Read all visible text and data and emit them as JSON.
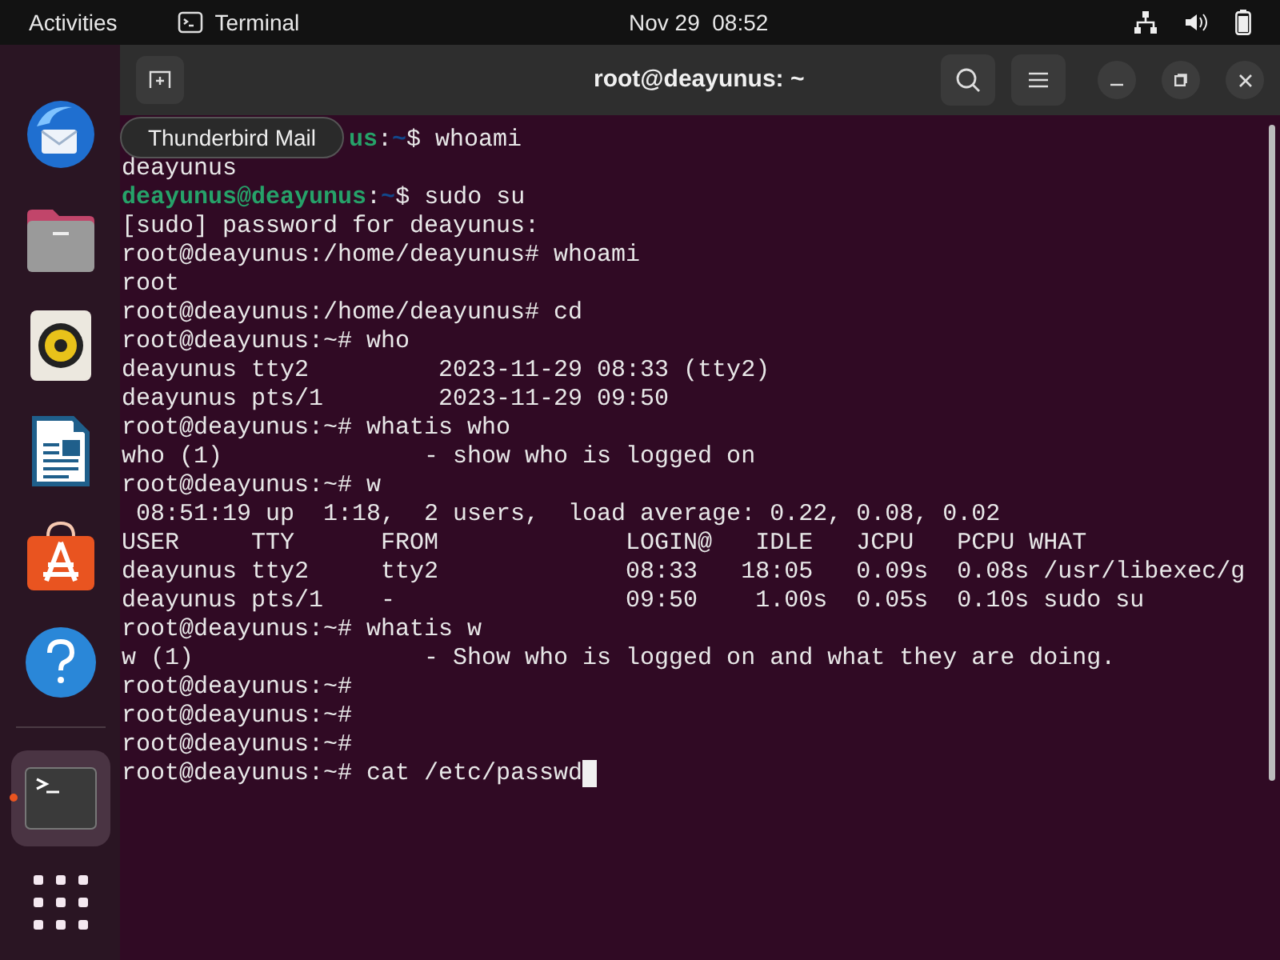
{
  "top_bar": {
    "activities": "Activities",
    "app_name": "Terminal",
    "clock": "Nov 29  08:52"
  },
  "dock": {
    "items": [
      {
        "kind": "mail",
        "running": false
      },
      {
        "kind": "files",
        "running": false
      },
      {
        "kind": "music",
        "running": false
      },
      {
        "kind": "writer",
        "running": false
      },
      {
        "kind": "store",
        "running": false
      },
      {
        "kind": "help",
        "running": false
      },
      {
        "kind": "terminal",
        "running": true
      }
    ],
    "tooltip": "Thunderbird Mail"
  },
  "window": {
    "title": "root@deayunus: ~"
  },
  "terminal": {
    "lines": [
      [
        {
          "text": "us",
          "kind": "user"
        },
        {
          "text": ":",
          "kind": "plain"
        },
        {
          "text": "~",
          "kind": "path"
        },
        {
          "text": "$ whoami",
          "kind": "plain"
        }
      ],
      [
        {
          "text": "deayunus",
          "kind": "plain"
        }
      ],
      [
        {
          "text": "deayunus@deayunus",
          "kind": "user"
        },
        {
          "text": ":",
          "kind": "plain"
        },
        {
          "text": "~",
          "kind": "path"
        },
        {
          "text": "$ sudo su",
          "kind": "plain"
        }
      ],
      [
        {
          "text": "[sudo] password for deayunus:",
          "kind": "plain"
        }
      ],
      [
        {
          "text": "root@deayunus:/home/deayunus# whoami",
          "kind": "plain"
        }
      ],
      [
        {
          "text": "root",
          "kind": "plain"
        }
      ],
      [
        {
          "text": "root@deayunus:/home/deayunus# cd",
          "kind": "plain"
        }
      ],
      [
        {
          "text": "root@deayunus:~# who",
          "kind": "plain"
        }
      ],
      [
        {
          "text": "deayunus tty2         2023-11-29 08:33 (tty2)",
          "kind": "plain"
        }
      ],
      [
        {
          "text": "deayunus pts/1        2023-11-29 09:50",
          "kind": "plain"
        }
      ],
      [
        {
          "text": "root@deayunus:~# whatis who",
          "kind": "plain"
        }
      ],
      [
        {
          "text": "who (1)              - show who is logged on",
          "kind": "plain"
        }
      ],
      [
        {
          "text": "root@deayunus:~# w",
          "kind": "plain"
        }
      ],
      [
        {
          "text": " 08:51:19 up  1:18,  2 users,  load average: 0.22, 0.08, 0.02",
          "kind": "plain"
        }
      ],
      [
        {
          "text": "USER     TTY      FROM             LOGIN@   IDLE   JCPU   PCPU WHAT",
          "kind": "plain"
        }
      ],
      [
        {
          "text": "deayunus tty2     tty2             08:33   18:05   0.09s  0.08s /usr/libexec/g",
          "kind": "plain"
        }
      ],
      [
        {
          "text": "deayunus pts/1    -                09:50    1.00s  0.05s  0.10s sudo su",
          "kind": "plain"
        }
      ],
      [
        {
          "text": "root@deayunus:~# whatis w",
          "kind": "plain"
        }
      ],
      [
        {
          "text": "w (1)                - Show who is logged on and what they are doing.",
          "kind": "plain"
        }
      ],
      [
        {
          "text": "root@deayunus:~#",
          "kind": "plain"
        }
      ],
      [
        {
          "text": "root@deayunus:~#",
          "kind": "plain"
        }
      ],
      [
        {
          "text": "root@deayunus:~#",
          "kind": "plain"
        }
      ],
      [
        {
          "text": "root@deayunus:~# cat /etc/passwd",
          "kind": "plain"
        }
      ]
    ]
  }
}
